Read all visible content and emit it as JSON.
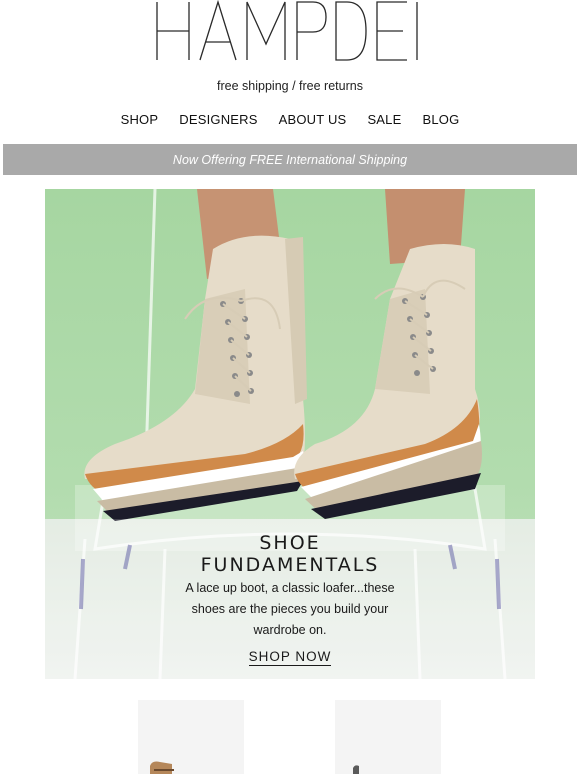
{
  "brand": {
    "logo_text": "HAMPDEN"
  },
  "header": {
    "tagline": "free shipping / free returns"
  },
  "nav": {
    "items": [
      {
        "label": "SHOP"
      },
      {
        "label": "DESIGNERS"
      },
      {
        "label": "ABOUT US"
      },
      {
        "label": "SALE"
      },
      {
        "label": "BLOG"
      }
    ]
  },
  "banner": {
    "text": "Now Offering FREE International Shipping"
  },
  "hero": {
    "title_line1": "SHOE",
    "title_line2": "FUNDAMENTALS",
    "body_lines": [
      "A lace up boot, a classic loafer...these",
      "shoes are the pieces you build your",
      "wardrobe on."
    ],
    "cta": "SHOP NOW"
  },
  "colors": {
    "banner_bg": "#a9a9a9",
    "hero_bg": "#a9d9a4",
    "boot": "#e6dcc9",
    "sole_tan": "#d08a4a"
  }
}
